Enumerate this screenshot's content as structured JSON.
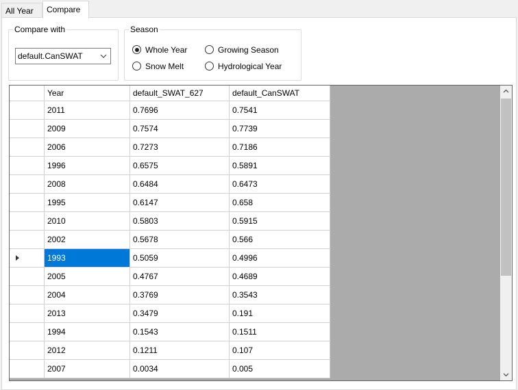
{
  "tabs": [
    {
      "label": "All Year",
      "active": false
    },
    {
      "label": "Compare",
      "active": true
    }
  ],
  "compare_with": {
    "legend": "Compare with",
    "selected": "default.CanSWAT"
  },
  "season": {
    "legend": "Season",
    "options": [
      {
        "label": "Whole Year",
        "checked": true
      },
      {
        "label": "Growing Season",
        "checked": false
      },
      {
        "label": "Snow Melt",
        "checked": false
      },
      {
        "label": "Hydrological Year",
        "checked": false
      }
    ]
  },
  "table": {
    "columns": [
      "Year",
      "default_SWAT_627",
      "default_CanSWAT"
    ],
    "rows": [
      [
        "2011",
        "0.7696",
        "0.7541"
      ],
      [
        "2009",
        "0.7574",
        "0.7739"
      ],
      [
        "2006",
        "0.7273",
        "0.7186"
      ],
      [
        "1996",
        "0.6575",
        "0.5891"
      ],
      [
        "2008",
        "0.6484",
        "0.6473"
      ],
      [
        "1995",
        "0.6147",
        "0.658"
      ],
      [
        "2010",
        "0.5803",
        "0.5915"
      ],
      [
        "2002",
        "0.5678",
        "0.566"
      ],
      [
        "1993",
        "0.5059",
        "0.4996"
      ],
      [
        "2005",
        "0.4767",
        "0.4689"
      ],
      [
        "2004",
        "0.3769",
        "0.3543"
      ],
      [
        "2013",
        "0.3479",
        "0.191"
      ],
      [
        "1994",
        "0.1543",
        "0.1511"
      ],
      [
        "2012",
        "0.1211",
        "0.107"
      ],
      [
        "2007",
        "0.0034",
        "0.005"
      ]
    ],
    "current_row": 8
  }
}
